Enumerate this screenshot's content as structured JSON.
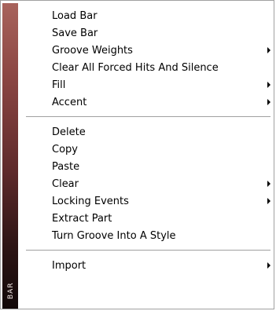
{
  "menu": {
    "side_strip_label": "BAR",
    "groups": [
      [
        {
          "label": "Load Bar",
          "submenu": false
        },
        {
          "label": "Save Bar",
          "submenu": false
        },
        {
          "label": "Groove Weights",
          "submenu": true
        },
        {
          "label": "Clear All Forced Hits And Silence",
          "submenu": false
        },
        {
          "label": "Fill",
          "submenu": true
        },
        {
          "label": "Accent",
          "submenu": true
        }
      ],
      [
        {
          "label": "Delete",
          "submenu": false
        },
        {
          "label": "Copy",
          "submenu": false
        },
        {
          "label": "Paste",
          "submenu": false
        },
        {
          "label": "Clear",
          "submenu": true
        },
        {
          "label": "Locking Events",
          "submenu": true
        },
        {
          "label": "Extract Part",
          "submenu": false
        },
        {
          "label": "Turn Groove Into A Style",
          "submenu": false
        }
      ],
      [
        {
          "label": "Import",
          "submenu": true
        }
      ]
    ]
  }
}
